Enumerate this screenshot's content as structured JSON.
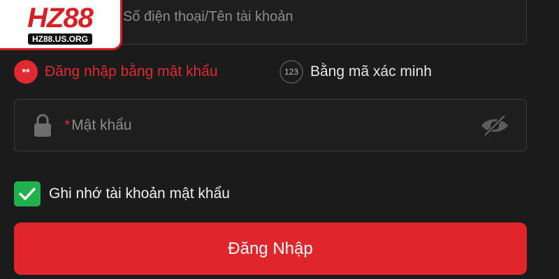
{
  "logo": {
    "mark": "HZ88",
    "domain": "HZ88.US.ORG"
  },
  "username": {
    "placeholder": "Số điện thoại/Tên tài khoản"
  },
  "login_modes": {
    "password": {
      "badge": "**",
      "label": "Đăng nhập bằng mật khẩu"
    },
    "code": {
      "badge": "123",
      "label": "Bằng mã xác minh"
    }
  },
  "password": {
    "required_mark": "*",
    "placeholder": "Mật khẩu"
  },
  "remember": {
    "label": "Ghi nhớ tài khoản mật khẩu",
    "checked": true
  },
  "login_button": {
    "label": "Đăng Nhập"
  },
  "colors": {
    "accent": "#e0262c",
    "check": "#1fb14c",
    "background": "#1b1b1b"
  },
  "icons": [
    "lock-icon",
    "eye-off-icon",
    "checkmark-icon"
  ]
}
